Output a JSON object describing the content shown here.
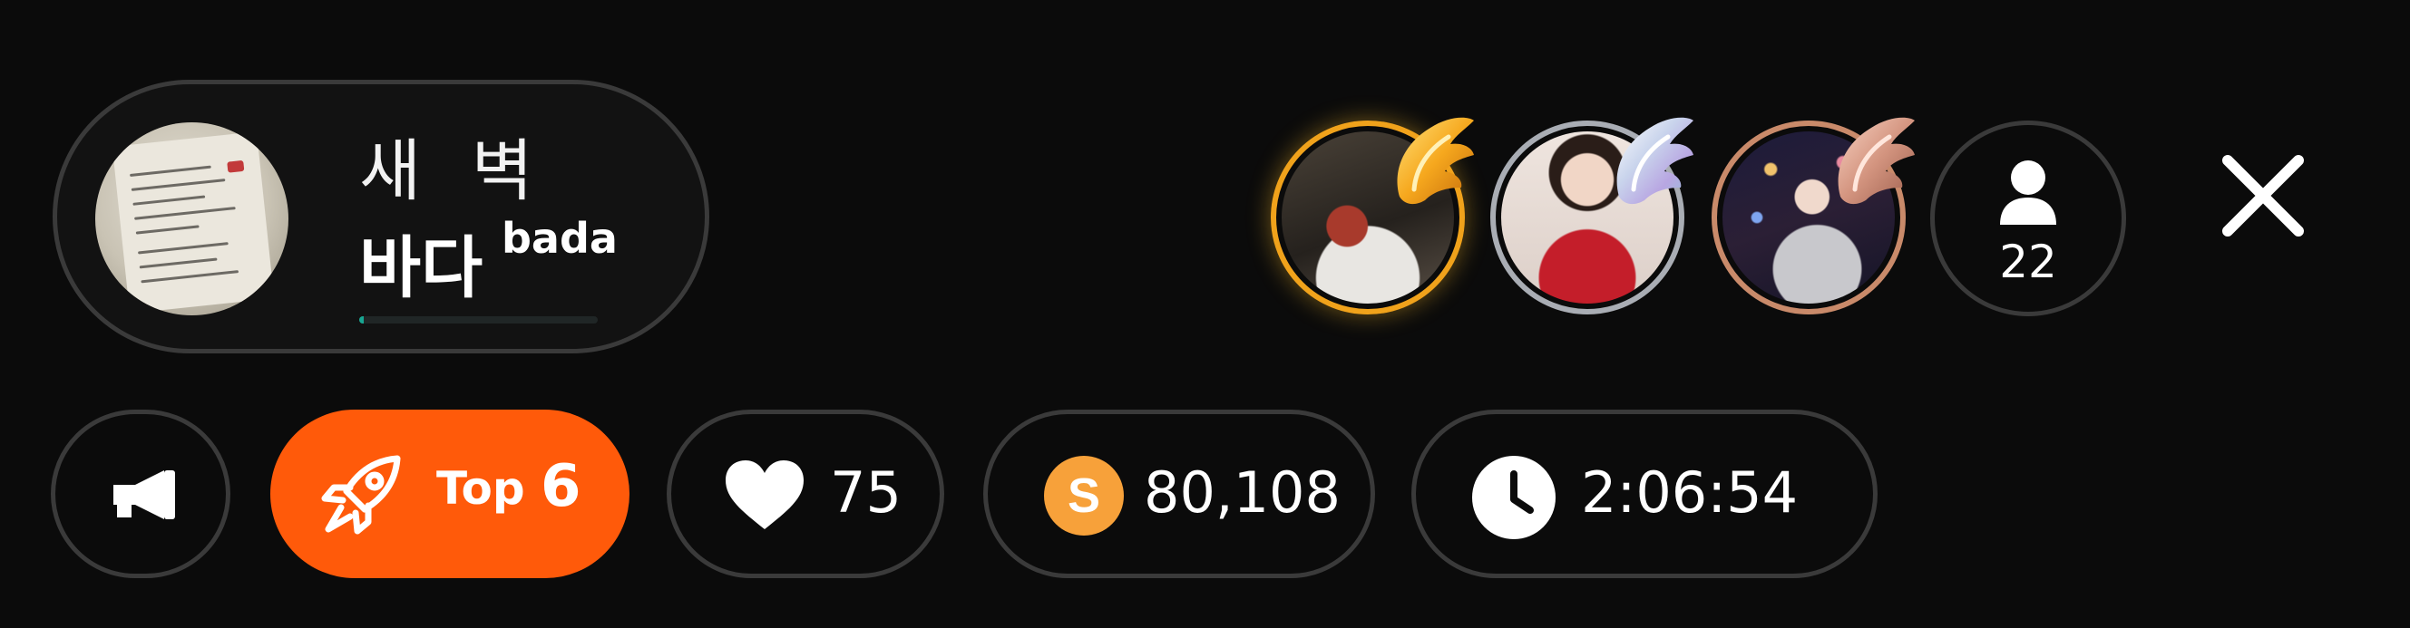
{
  "host": {
    "subtitle": "새 벽",
    "name": "바다",
    "handle": "bada",
    "thumbnail_icon": "handwritten-note-photo",
    "progress_fraction": 0.02
  },
  "top_fans": [
    {
      "rank": 1,
      "badge_color": "#f0a21b",
      "badge_icon": "gold-wing-icon"
    },
    {
      "rank": 2,
      "badge_color": "#a9adb4",
      "badge_icon": "silver-wing-icon"
    },
    {
      "rank": 3,
      "badge_color": "#c98a6a",
      "badge_icon": "bronze-wing-icon"
    }
  ],
  "listeners": {
    "count": "22",
    "icon": "person-icon"
  },
  "close_icon": "close-icon",
  "stats": {
    "notice_icon": "megaphone-icon",
    "rank_label": "Top",
    "rank_value": "6",
    "rank_icon": "rocket-icon",
    "rank_color": "#ff5a0a",
    "likes": "75",
    "likes_icon": "heart-icon",
    "spoons": "80,108",
    "spoon_icon": "spoon-coin-icon",
    "spoon_letter": "S",
    "coin_color": "#f7a13a",
    "elapsed": "2:06:54",
    "elapsed_icon": "clock-icon"
  }
}
